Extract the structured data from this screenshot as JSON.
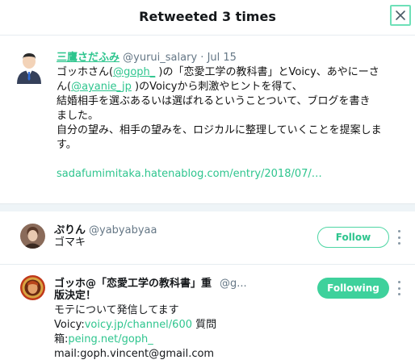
{
  "modal": {
    "title": "Retweeted 3 times"
  },
  "tweet": {
    "name": "三鷹さだふみ",
    "handle": "@yurui_salary",
    "dot": "·",
    "date": "Jul 15",
    "line1a": "ゴッホさん(",
    "mention1": "@goph_",
    "line1b": " )の「恋愛工学の教科書」とVoicy、あやにーさ",
    "line2a": "ん(",
    "mention2": "@ayanie_jp",
    "line2b": " )のVoicyから刺激やヒントを得て、",
    "line3": "結婚相手を選ぶあるいは選ばれるということついて、ブログを書き",
    "line4": "ました。",
    "line5": "自分の望み、相手の望みを、ロジカルに整理していくことを提案しま",
    "line6": "す。",
    "link": "sadafumimitaka.hatenablog.com/entry/2018/07/…"
  },
  "users": [
    {
      "name": "ぷりん",
      "handle": "@yabyabyaa",
      "bio": "ゴマキ",
      "button": "Follow"
    },
    {
      "name": "ゴッホ@「恋愛工学の教科書」重",
      "handle": "@g...",
      "bio1": "版決定！",
      "bio2": "モテについて発信してます",
      "bio3a": "Voicy:",
      "bio3link": "voicy.jp/channel/600",
      "bio3b": " 質問",
      "bio4a": "箱:",
      "bio4link": "peing.net/goph_",
      "bio5": "mail:goph.vincent@gmail.com",
      "button": "Following"
    }
  ]
}
